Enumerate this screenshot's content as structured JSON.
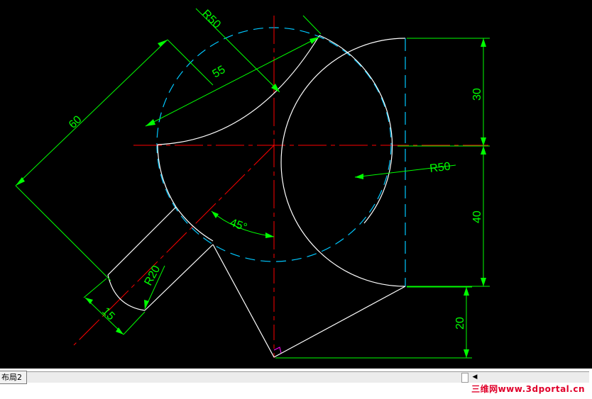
{
  "colors": {
    "background": "#000000",
    "geometry": "#ffffff",
    "dimension": "#00ff00",
    "centerline": "#ff0000",
    "hidden_circle": "#00c8ff",
    "marker": "#ff00ff"
  },
  "dimensions": {
    "r50_top": "R50",
    "len_55": "55",
    "len_60": "60",
    "len_30": "30",
    "r50_right": "R50",
    "len_40": "40",
    "angle_45": "45°",
    "r20": "R20",
    "len_15": "15",
    "len_20": "20"
  },
  "statusbar": {
    "layout_tab": "布局2",
    "watermark": "三维网www.3dportal.cn",
    "scroll_left_icon": "arrow-left-icon"
  }
}
